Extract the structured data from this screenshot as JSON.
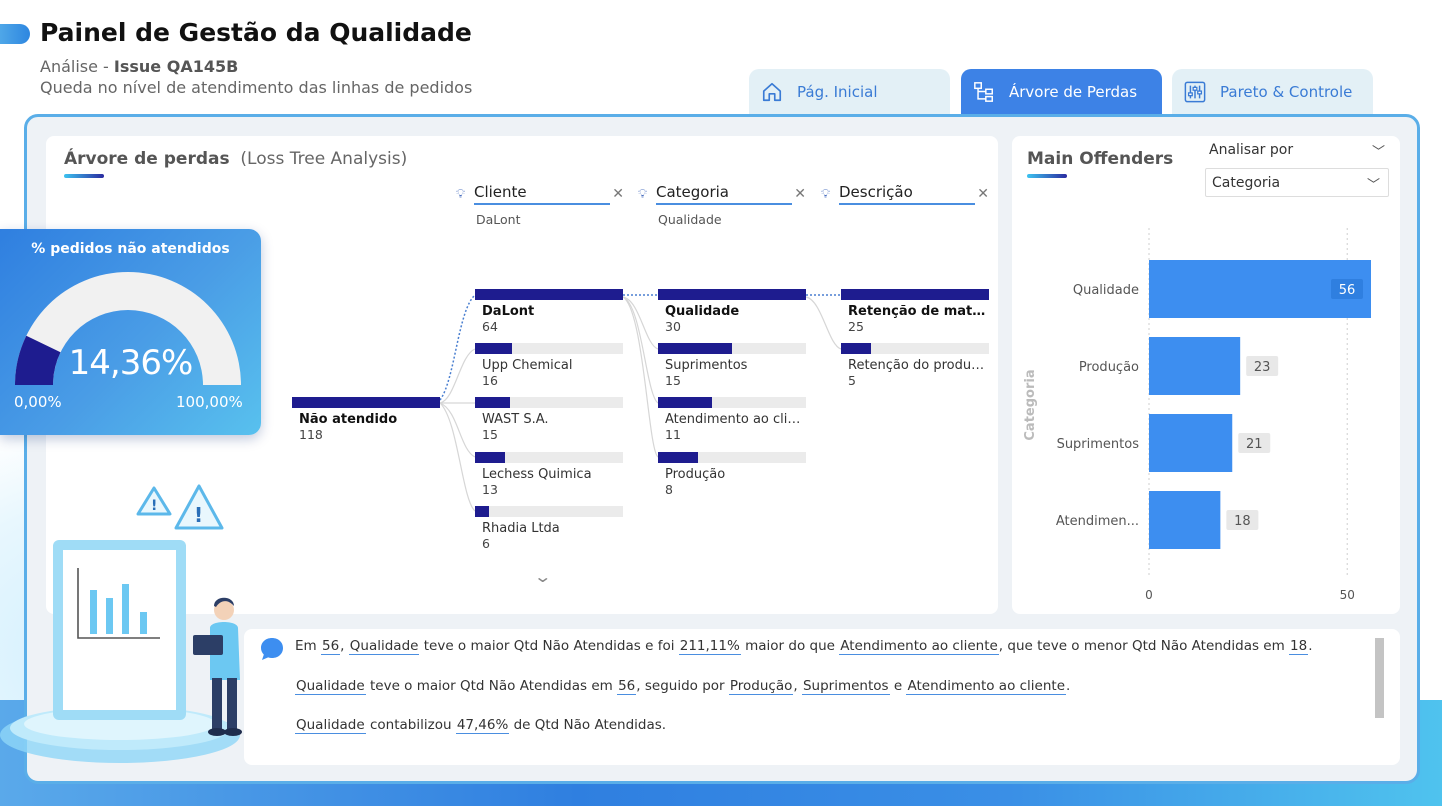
{
  "header": {
    "title": "Painel de Gestão da Qualidade",
    "analysis_prefix": "Análise - ",
    "issue": "Issue QA145B",
    "description": "Queda no nível de atendimento das linhas de pedidos"
  },
  "tabs": [
    {
      "label": "Pág. Inicial",
      "icon": "home-icon",
      "active": false
    },
    {
      "label": "Árvore de Perdas",
      "icon": "tree-icon",
      "active": true
    },
    {
      "label": "Pareto & Controle",
      "icon": "sliders-icon",
      "active": false
    }
  ],
  "gauge": {
    "title": "% pedidos não atendidos",
    "value_text": "14,36%",
    "value": 14.36,
    "min_label": "0,00%",
    "max_label": "100,00%",
    "fill_color": "#1e1c8f",
    "track_color": "#f1f1f1"
  },
  "tree": {
    "title": "Árvore de perdas",
    "subtitle": "(Loss Tree Analysis)",
    "root": {
      "label": "Não atendido",
      "value": "118",
      "fraction": 1.0
    },
    "levels": [
      {
        "name": "Cliente",
        "selected": "DaLont",
        "nodes": [
          {
            "label": "DaLont",
            "value": "64",
            "fraction": 1.0,
            "active": true
          },
          {
            "label": "Upp Chemical",
            "value": "16",
            "fraction": 0.25
          },
          {
            "label": "WAST S.A.",
            "value": "15",
            "fraction": 0.234
          },
          {
            "label": "Lechess Quimica",
            "value": "13",
            "fraction": 0.203
          },
          {
            "label": "Rhadia Ltda",
            "value": "6",
            "fraction": 0.094
          }
        ]
      },
      {
        "name": "Categoria",
        "selected": "Qualidade",
        "nodes": [
          {
            "label": "Qualidade",
            "value": "30",
            "fraction": 1.0,
            "active": true
          },
          {
            "label": "Suprimentos",
            "value": "15",
            "fraction": 0.5
          },
          {
            "label": "Atendimento ao cliente",
            "value": "11",
            "fraction": 0.367
          },
          {
            "label": "Produção",
            "value": "8",
            "fraction": 0.267
          }
        ]
      },
      {
        "name": "Descrição",
        "selected": "",
        "nodes": [
          {
            "label": "Retenção de matéria...",
            "value": "25",
            "fraction": 1.0,
            "active": true
          },
          {
            "label": "Retenção do produto f...",
            "value": "5",
            "fraction": 0.2
          }
        ]
      }
    ]
  },
  "offenders": {
    "title": "Main Offenders",
    "dropdown_label": "Analisar por",
    "dropdown_value": "Categoria"
  },
  "chart_data": {
    "type": "bar",
    "orientation": "horizontal",
    "title": "",
    "ylabel": "Categoria",
    "xlabel": "",
    "categories": [
      "Qualidade",
      "Produção",
      "Suprimentos",
      "Atendimen..."
    ],
    "values": [
      56,
      23,
      21,
      18
    ],
    "xlim": [
      0,
      56
    ],
    "xticks": [
      "0",
      "50"
    ],
    "grid": true,
    "bar_color": "#3d8ef0"
  },
  "narrative": {
    "line1": [
      {
        "t": "Em ",
        "u": false
      },
      {
        "t": "56",
        "u": true
      },
      {
        "t": ", ",
        "u": false
      },
      {
        "t": "Qualidade",
        "u": true
      },
      {
        "t": " teve o maior Qtd Não Atendidas e foi ",
        "u": false
      },
      {
        "t": "211,11%",
        "u": true
      },
      {
        "t": " maior do que ",
        "u": false
      },
      {
        "t": "Atendimento ao cliente",
        "u": true
      },
      {
        "t": ", que teve o menor Qtd Não Atendidas em ",
        "u": false
      },
      {
        "t": "18",
        "u": true
      },
      {
        "t": ".",
        "u": false
      }
    ],
    "line2": [
      {
        "t": "Qualidade",
        "u": true
      },
      {
        "t": " teve o maior Qtd Não Atendidas em ",
        "u": false
      },
      {
        "t": "56",
        "u": true
      },
      {
        "t": ", seguido por ",
        "u": false
      },
      {
        "t": "Produção",
        "u": true
      },
      {
        "t": ", ",
        "u": false
      },
      {
        "t": "Suprimentos",
        "u": true
      },
      {
        "t": " e ",
        "u": false
      },
      {
        "t": "Atendimento ao cliente",
        "u": true
      },
      {
        "t": ".",
        "u": false
      }
    ],
    "line3": [
      {
        "t": "Qualidade",
        "u": true
      },
      {
        "t": " contabilizou ",
        "u": false
      },
      {
        "t": "47,46%",
        "u": true
      },
      {
        "t": " de Qtd Não Atendidas.",
        "u": false
      }
    ]
  }
}
